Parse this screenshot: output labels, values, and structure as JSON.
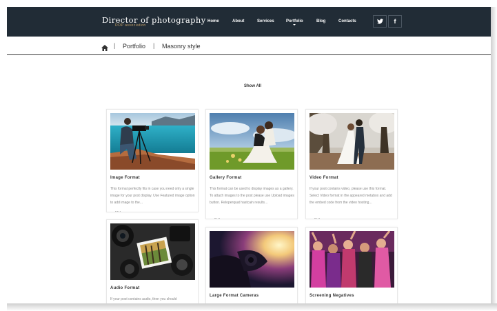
{
  "site": {
    "title": "Director of photography",
    "subtitle": "DOP association"
  },
  "nav": {
    "items": [
      "Home",
      "About",
      "Services",
      "Portfolio",
      "Blog",
      "Contacts"
    ],
    "social": [
      "twitter-icon",
      "facebook-icon"
    ],
    "social_glyphs": [
      "🐦",
      "f"
    ]
  },
  "breadcrumb": {
    "home_icon": "home-icon",
    "home_glyph": "⌂",
    "sep": "|",
    "items": [
      "Portfolio",
      "Masonry style"
    ]
  },
  "filter": {
    "show_all": "Show All"
  },
  "cards": [
    {
      "title": "Image Format",
      "text": "This format perfectly fits in case you need only a single image for your post display. Use Featured image option to add image to the...",
      "image": "photographer-tripod-lake"
    },
    {
      "title": "Gallery Format",
      "text": "This format can be used to display images as a gallery. To attach images to the post please use Upload images button. Reloperquat hastcain results...",
      "image": "wedding-couple-field"
    },
    {
      "title": "Video Format",
      "text": "If your post contains video, please use this format. Select Video format in the appeared metabox and add the embed code from the video hosting...",
      "image": "wedding-couple-trees"
    },
    {
      "title": "Audio Format",
      "text": "If your post contains audio, then you should",
      "image": "cameras-and-photos"
    },
    {
      "title": "Large Format Cameras",
      "text": "",
      "image": "camera-silhouette-light"
    },
    {
      "title": "Screening Negatives",
      "text": "",
      "image": "party-crowd"
    }
  ],
  "colors": {
    "topbar": "#212c36",
    "accent": "#c9a46a"
  }
}
